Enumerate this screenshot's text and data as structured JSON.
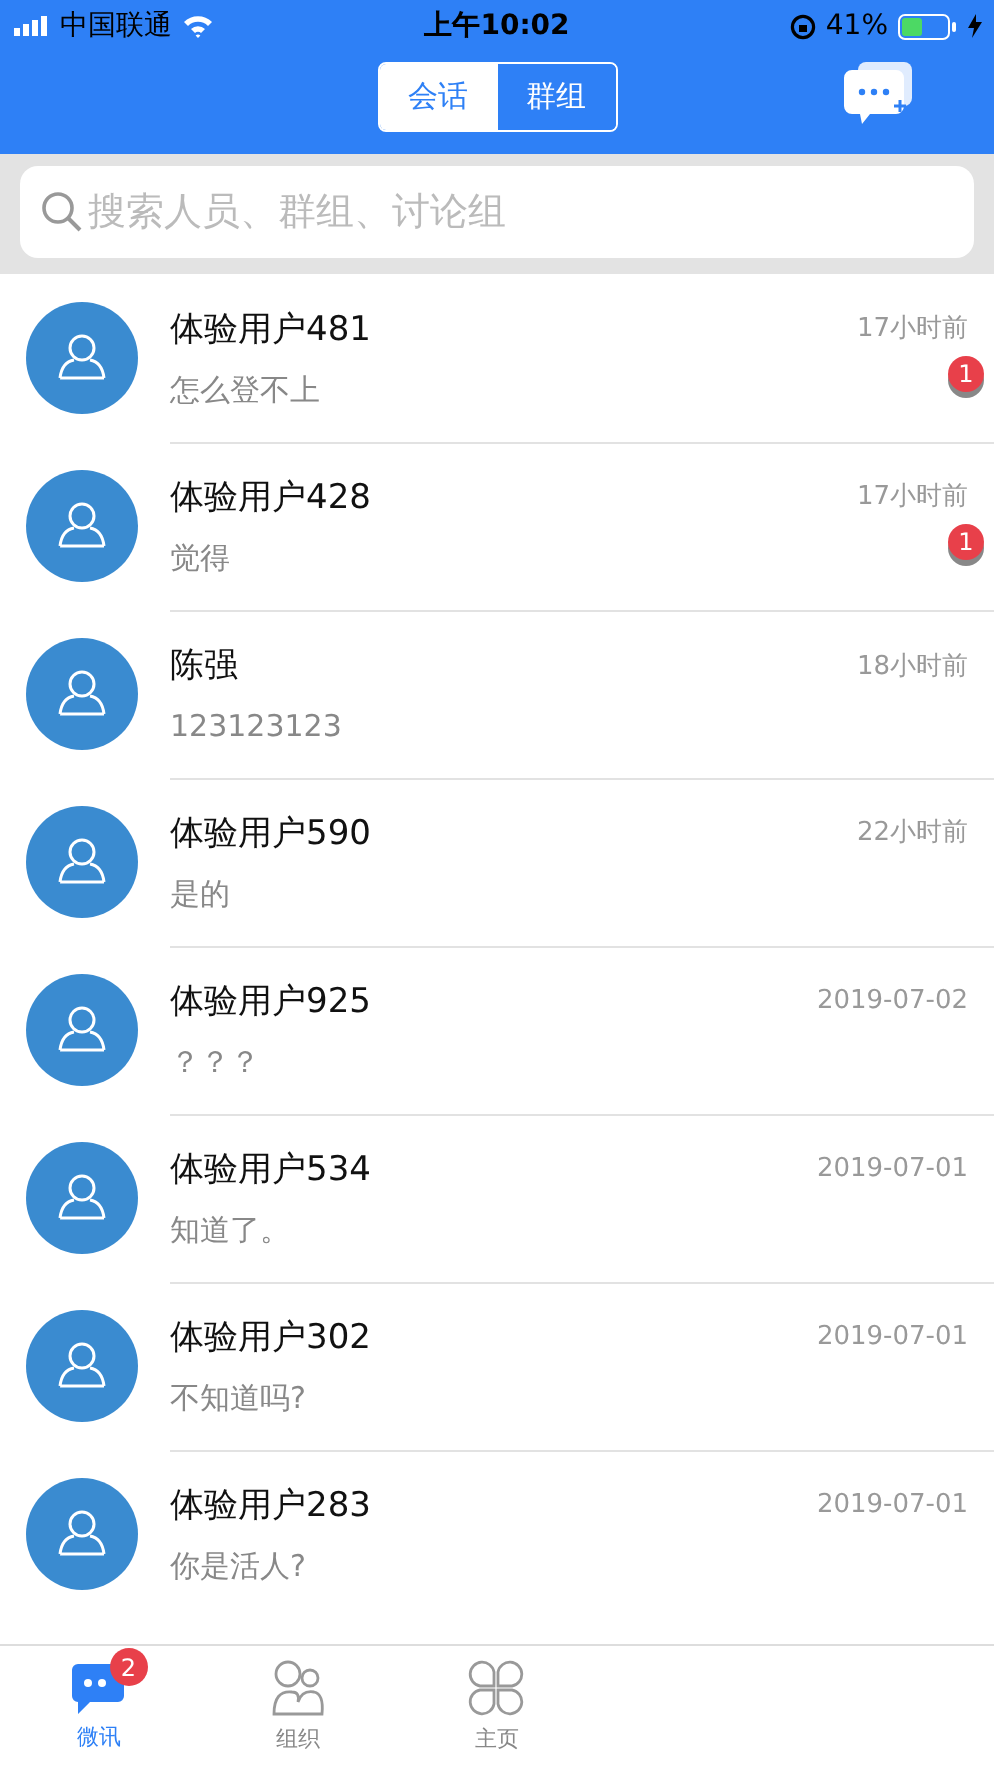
{
  "status_bar": {
    "carrier": "中国联通",
    "time": "上午10:02",
    "battery": "41%"
  },
  "header": {
    "segments": [
      {
        "label": "会话",
        "selected": true
      },
      {
        "label": "群组",
        "selected": false
      }
    ]
  },
  "search": {
    "placeholder": "搜索人员、群组、讨论组"
  },
  "conversations": [
    {
      "name": "体验用户481",
      "time": "17小时前",
      "message": "怎么登不上",
      "unread": "1"
    },
    {
      "name": "体验用户428",
      "time": "17小时前",
      "message": "觉得",
      "unread": "1"
    },
    {
      "name": "陈强",
      "time": "18小时前",
      "message": "123123123"
    },
    {
      "name": "体验用户590",
      "time": "22小时前",
      "message": "是的"
    },
    {
      "name": "体验用户925",
      "time": "2019-07-02",
      "message": "？？？"
    },
    {
      "name": "体验用户534",
      "time": "2019-07-01",
      "message": "知道了。"
    },
    {
      "name": "体验用户302",
      "time": "2019-07-01",
      "message": "不知道吗?"
    },
    {
      "name": "体验用户283",
      "time": "2019-07-01",
      "message": "你是活人?"
    }
  ],
  "tab_bar": [
    {
      "kind": "chat",
      "label": "微讯",
      "selected": true,
      "badge": "2"
    },
    {
      "kind": "people",
      "label": "组织",
      "selected": false
    },
    {
      "kind": "home",
      "label": "主页",
      "selected": false
    }
  ]
}
